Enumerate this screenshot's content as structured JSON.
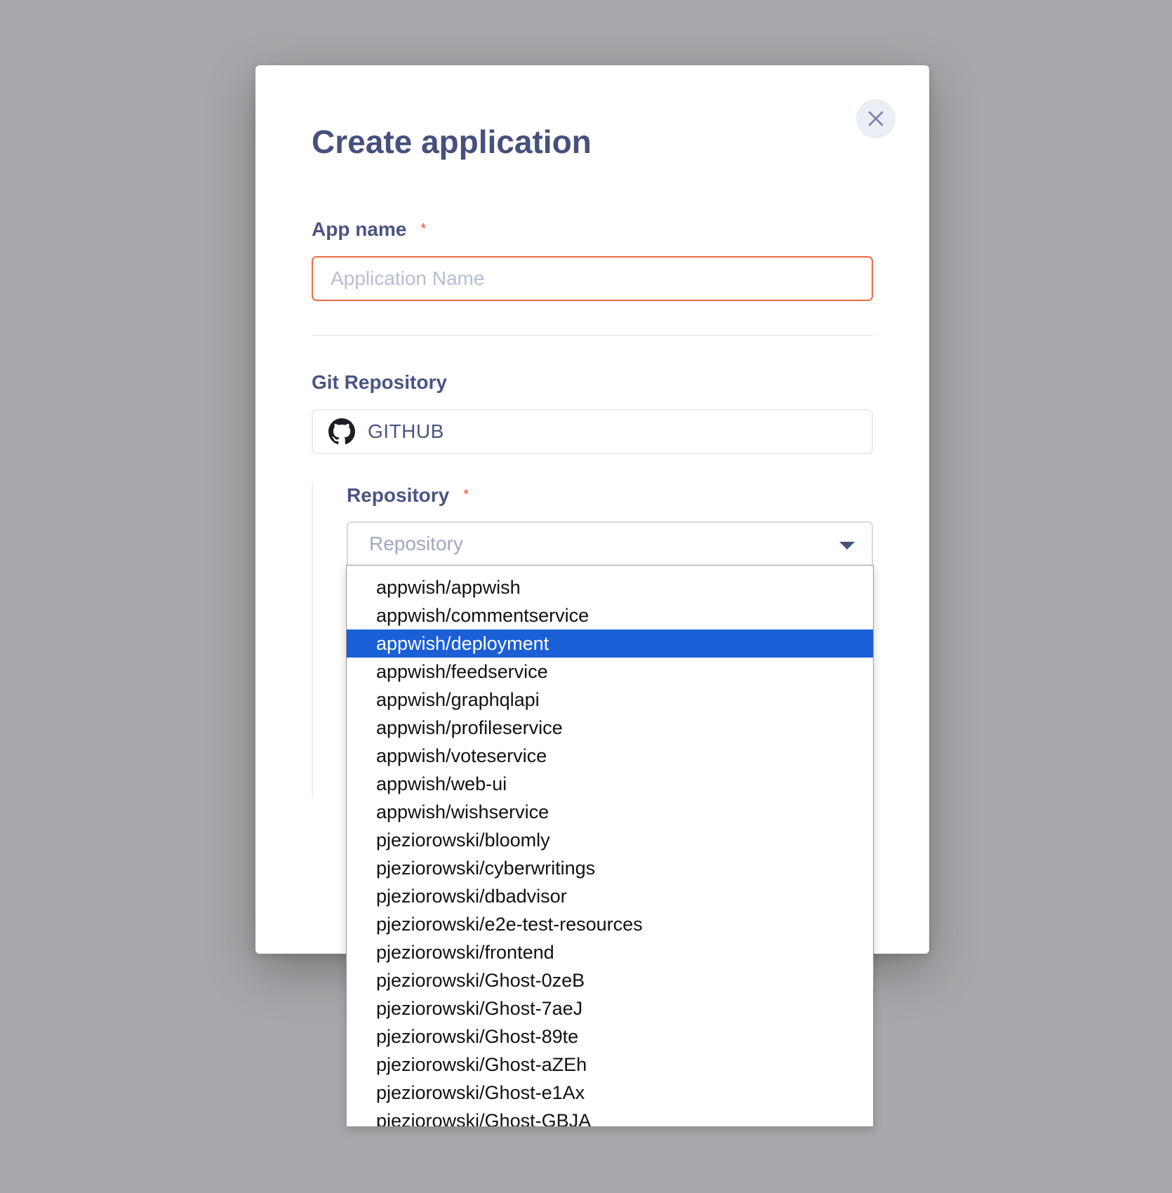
{
  "modal": {
    "title": "Create application",
    "close_icon": "close-icon"
  },
  "app_name": {
    "label": "App name",
    "required_mark": "*",
    "placeholder": "Application Name",
    "value": ""
  },
  "git": {
    "label": "Git Repository",
    "provider": "GITHUB",
    "provider_icon": "github-icon"
  },
  "repository": {
    "label": "Repository",
    "required_mark": "*",
    "placeholder": "Repository",
    "dropdown_icon": "chevron-down-icon",
    "selected": "appwish/deployment",
    "options": [
      "appwish/appwish",
      "appwish/commentservice",
      "appwish/deployment",
      "appwish/feedservice",
      "appwish/graphqlapi",
      "appwish/profileservice",
      "appwish/voteservice",
      "appwish/web-ui",
      "appwish/wishservice",
      "pjeziorowski/bloomly",
      "pjeziorowski/cyberwritings",
      "pjeziorowski/dbadvisor",
      "pjeziorowski/e2e-test-resources",
      "pjeziorowski/frontend",
      "pjeziorowski/Ghost-0zeB",
      "pjeziorowski/Ghost-7aeJ",
      "pjeziorowski/Ghost-89te",
      "pjeziorowski/Ghost-aZEh",
      "pjeziorowski/Ghost-e1Ax",
      "pjeziorowski/Ghost-GBJA"
    ]
  },
  "colors": {
    "backdrop": "#a7a8ab",
    "title": "#46507c",
    "required": "#e2502f",
    "error_border": "#ec6b45",
    "selected_option": "#1b5fd6"
  }
}
